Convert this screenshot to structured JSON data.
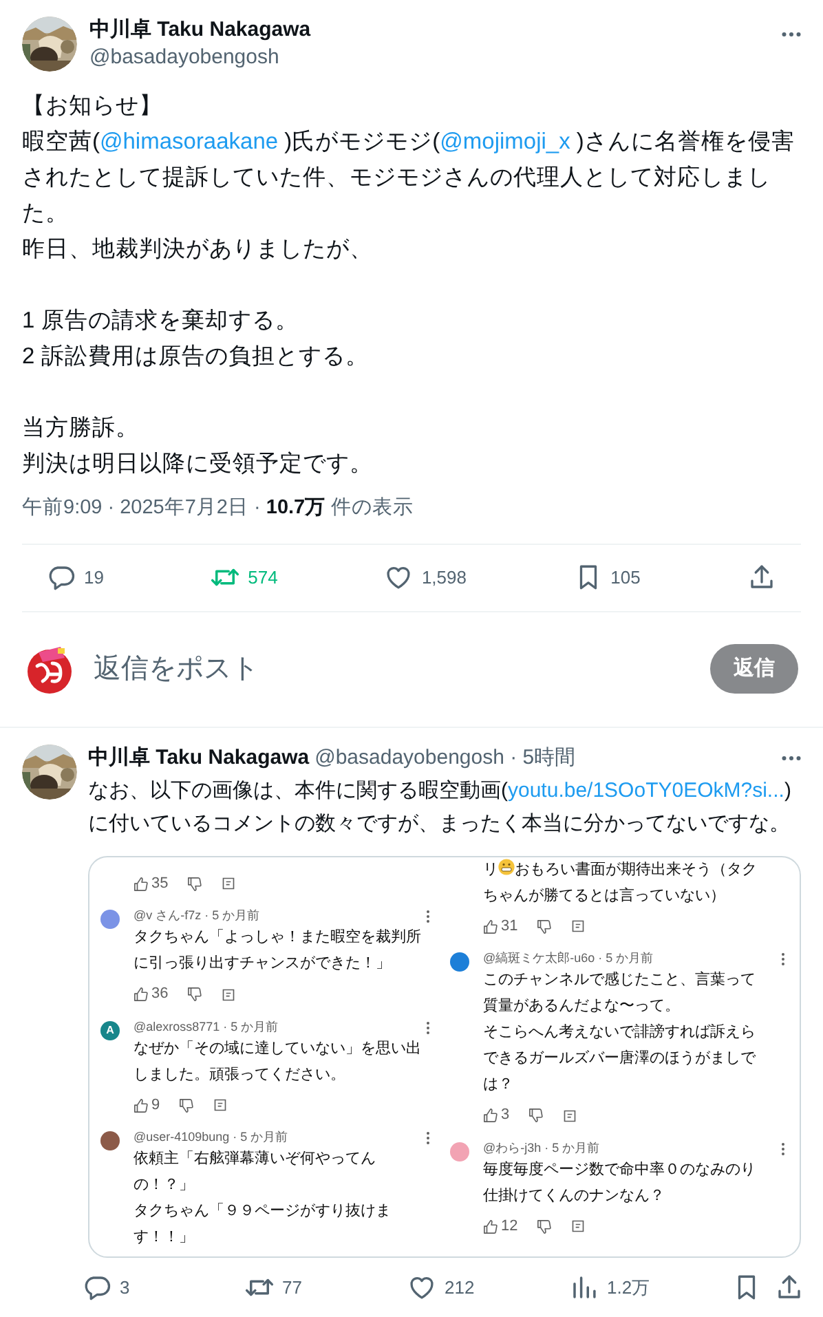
{
  "tweet": {
    "name": "中川卓 Taku Nakagawa",
    "handle": "@basadayobengosh",
    "body": [
      [
        [
          {
            "kind": "text",
            "text": "【お知らせ】"
          }
        ],
        [
          {
            "kind": "text",
            "text": "暇空茜("
          },
          {
            "kind": "mention",
            "text": "@himasoraakane"
          },
          {
            "kind": "text",
            "text": " )氏がモジモジ("
          },
          {
            "kind": "mention",
            "text": "@mojimoji_x"
          },
          {
            "kind": "text",
            "text": " )さんに名誉権を侵害されたとして提訴していた件、モジモジさんの代理人として対応しました。"
          }
        ],
        [
          {
            "kind": "text",
            "text": "昨日、地裁判決がありましたが、"
          }
        ]
      ],
      [
        [
          {
            "kind": "text",
            "text": "1 原告の請求を棄却する。"
          }
        ],
        [
          {
            "kind": "text",
            "text": "2 訴訟費用は原告の負担とする。"
          }
        ]
      ],
      [
        [
          {
            "kind": "text",
            "text": "当方勝訴。"
          }
        ],
        [
          {
            "kind": "text",
            "text": "判決は明日以降に受領予定です。"
          }
        ]
      ]
    ],
    "meta": "午前9:09 · 2025年7月2日 · **10.7万** 件の表示",
    "actions": [
      {
        "kind": "reply",
        "count": "19",
        "active": false
      },
      {
        "kind": "retweet",
        "count": "574",
        "active": true
      },
      {
        "kind": "like",
        "count": "1,598",
        "active": false
      },
      {
        "kind": "bookmark",
        "count": "105",
        "active": false
      },
      {
        "kind": "share",
        "active": false
      }
    ]
  },
  "composer": {
    "placeholder": "返信をポスト",
    "button": "返信",
    "disabled": true
  },
  "reply": {
    "name": "中川卓 Taku Nakagawa",
    "handle_time": "@basadayobengosh · 5時間",
    "text": [
      {
        "kind": "text",
        "text": "なお、以下の画像は、本件に関する暇空動画("
      },
      {
        "kind": "link",
        "text": "youtu.be/1SOoTY0EOkM?si..."
      },
      {
        "kind": "text",
        "text": ")に付いているコメントの数々ですが、まったく本当に分かってないですな。"
      }
    ],
    "image": {
      "columns": [
        [
          {
            "kind": "tail",
            "likes": "35"
          },
          {
            "kind": "comment",
            "author": "@v さん-f7z · 5 か月前",
            "color": "#7b93e6",
            "lines": [
              "タクちゃん「よっしゃ！また暇空を裁判所",
              "に引っ張り出すチャンスができた！」"
            ],
            "likes": "36"
          },
          {
            "kind": "comment",
            "author": "@alexross8771 · 5 か月前",
            "color": "#17868b",
            "letter": "A",
            "lines": [
              "なぜか「その域に達していない」を思い出",
              "しました。頑張ってください。"
            ],
            "likes": "9"
          },
          {
            "kind": "comment",
            "author": "@user-4109bung · 5 か月前",
            "color": "#8c5a48",
            "lines": [
              "依頼主「右舷弾幕薄いぞ何やってん",
              "の！？」",
              "タクちゃん「９９ページがすり抜けま",
              "す！！」"
            ]
          }
        ],
        [
          {
            "kind": "tail",
            "lines": [
              {
                "before": "リ",
                "after": "おもろい書面が期待出来そう（タク"
              },
              "ちゃんが勝てるとは言っていない）"
            ],
            "likes": "31"
          },
          {
            "kind": "comment",
            "author": "@縞斑ミケ太郎-u6o · 5 か月前",
            "color": "#1d7fd8",
            "lines": [
              "このチャンネルで感じたこと、言葉って",
              "質量があるんだよな〜って。",
              "そこらへん考えないで誹謗すれば訴えら",
              "できるガールズバー唐澤のほうがましで",
              "は？"
            ],
            "likes": "3"
          },
          {
            "kind": "comment",
            "author": "@わら-j3h · 5 か月前",
            "color": "#f2a3b3",
            "lines": [
              "毎度毎度ページ数で命中率０のなみのり",
              "仕掛けてくんのナンなん？"
            ],
            "likes": "12"
          }
        ]
      ]
    },
    "actions": [
      {
        "kind": "reply",
        "count": "3",
        "active": false
      },
      {
        "kind": "retweet",
        "count": "77",
        "active": false
      },
      {
        "kind": "like",
        "count": "212",
        "active": false
      },
      {
        "kind": "views",
        "count": "1.2万",
        "active": false
      },
      {
        "kind": "bookmark",
        "active": false
      },
      {
        "kind": "share",
        "active": false
      }
    ]
  }
}
